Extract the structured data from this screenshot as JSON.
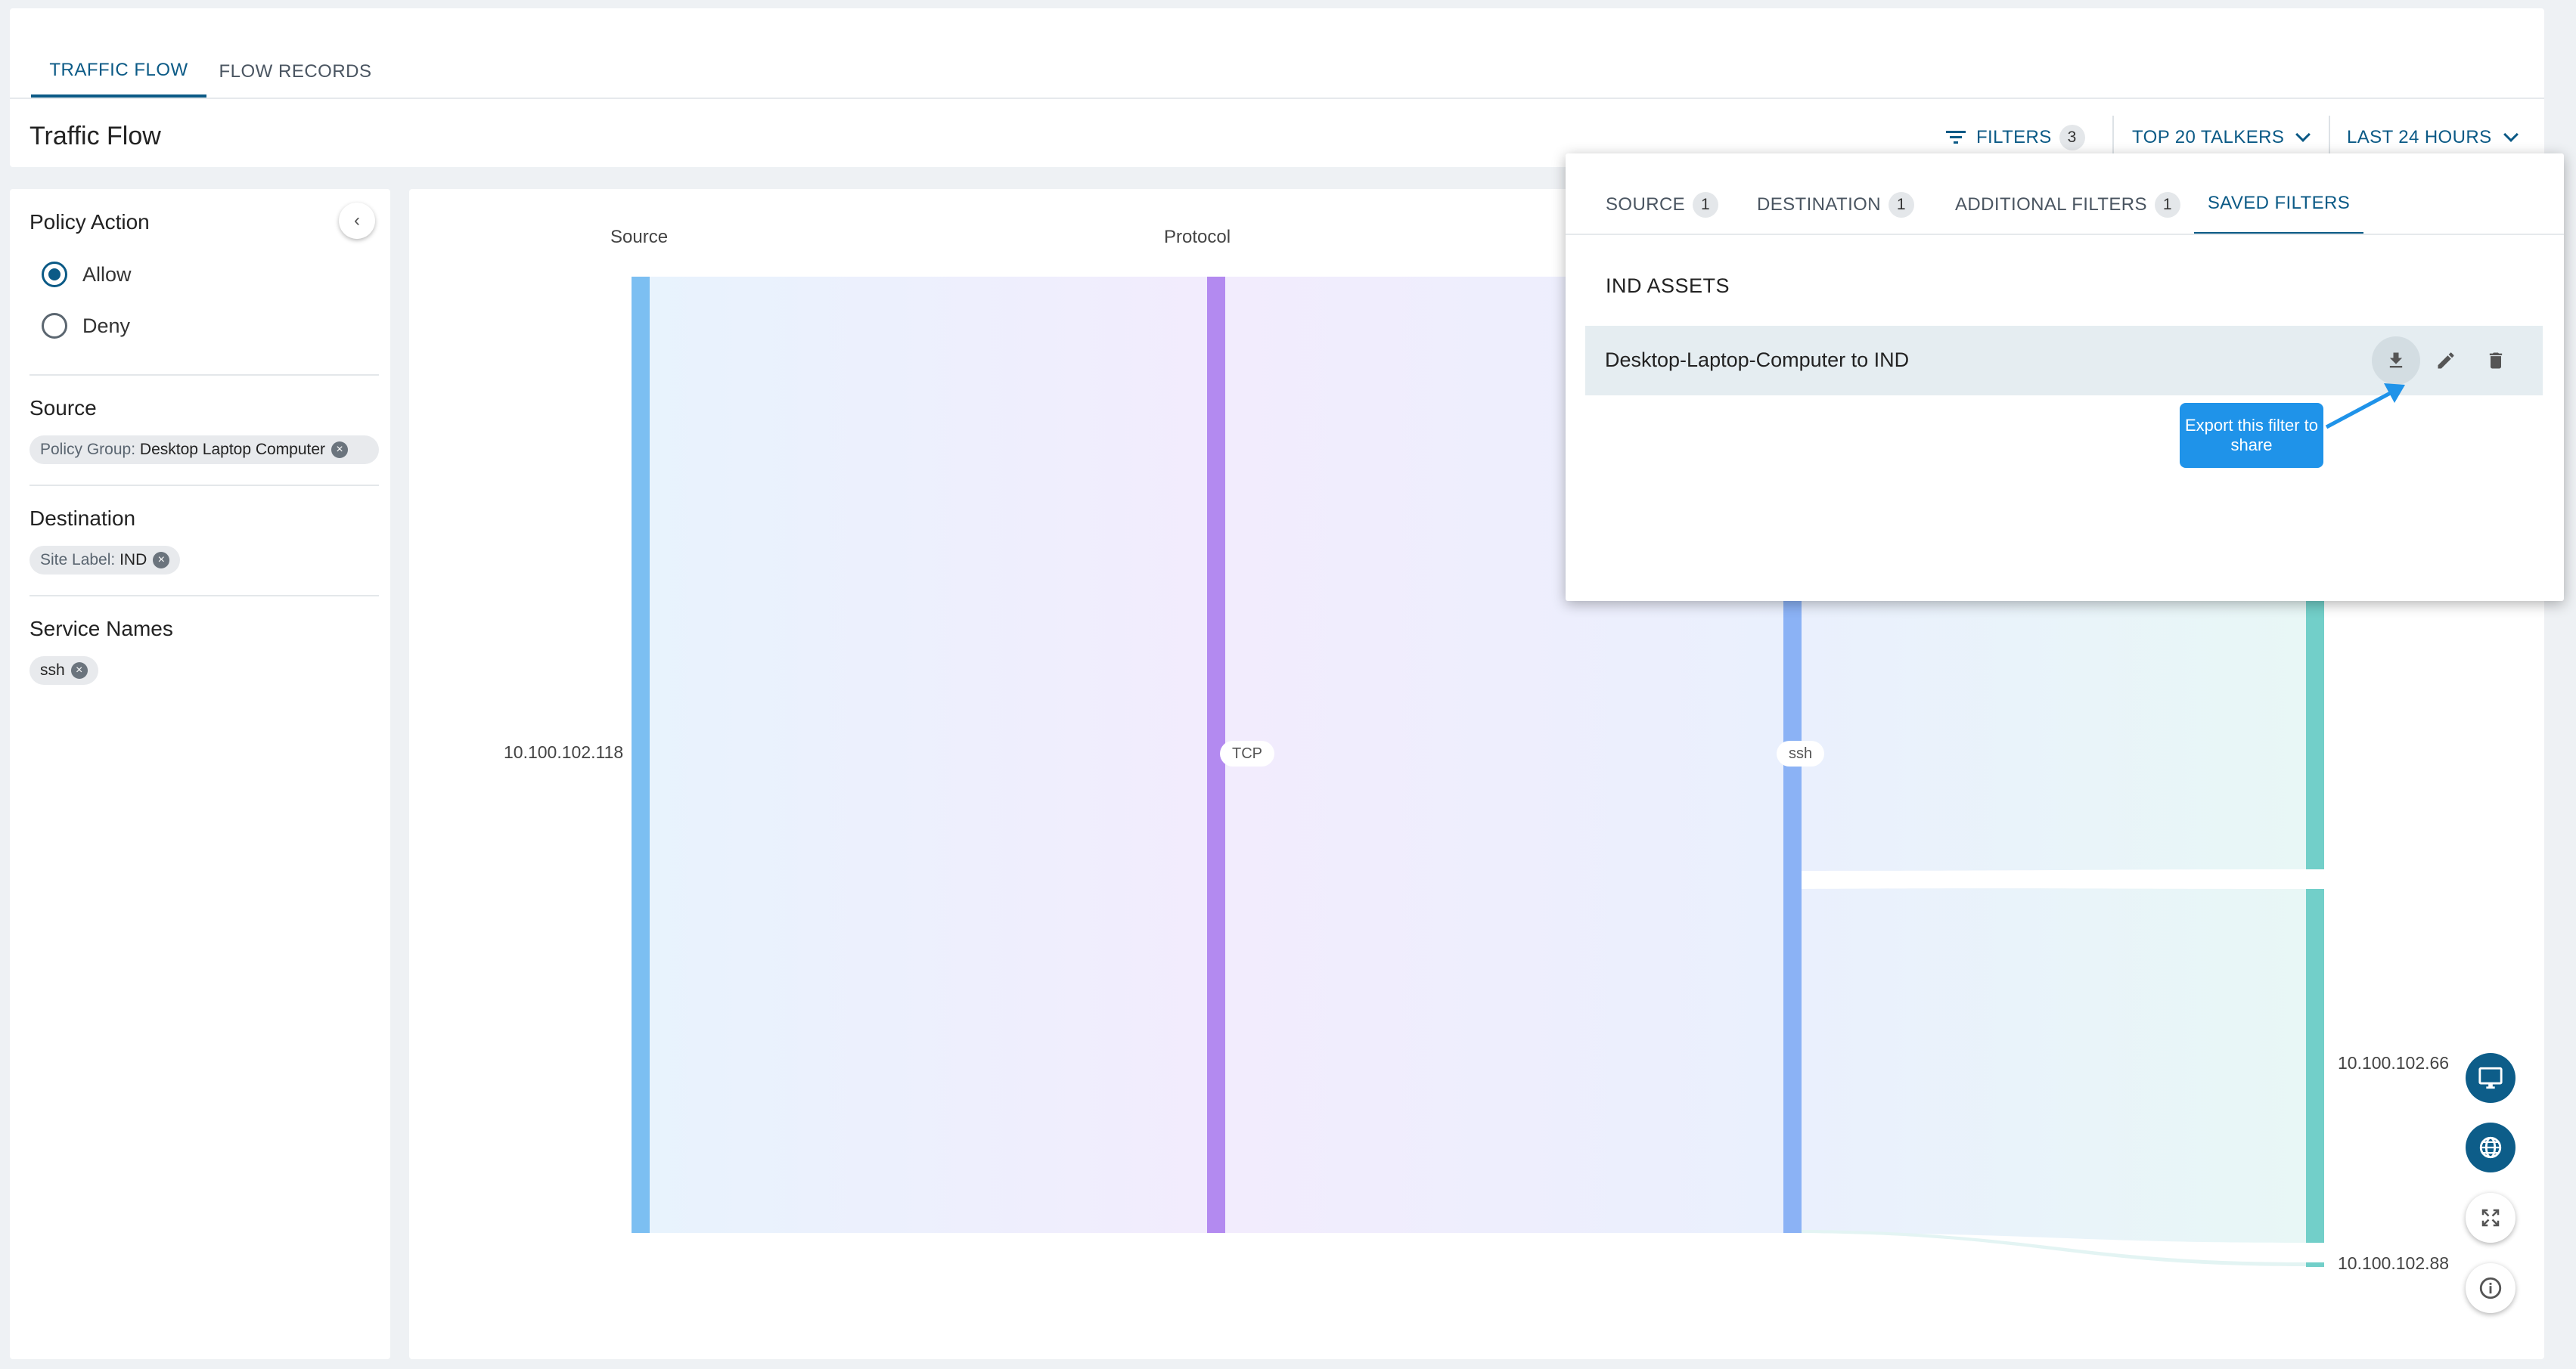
{
  "tabs": [
    {
      "label": "TRAFFIC FLOW"
    },
    {
      "label": "FLOW RECORDS"
    }
  ],
  "page_title": "Traffic Flow",
  "toolbar": {
    "filters_label": "FILTERS",
    "filters_count": "3",
    "talkers_label": "TOP 20 TALKERS",
    "range_label": "LAST 24 HOURS"
  },
  "left_panel": {
    "policy_action": {
      "label": "Policy Action",
      "options": [
        "Allow",
        "Deny"
      ],
      "selected": "Allow"
    },
    "source": {
      "label": "Source",
      "chip_key": "Policy Group:",
      "chip_value": "Desktop Laptop Computer"
    },
    "destination": {
      "label": "Destination",
      "chip_key": "Site Label:",
      "chip_value": "IND"
    },
    "service_names": {
      "label": "Service Names",
      "chip_value": "ssh"
    }
  },
  "sankey": {
    "columns": [
      "Source",
      "Protocol"
    ],
    "nodes": {
      "source": "10.100.102.118",
      "protocol": "TCP",
      "service": "ssh",
      "destinations": [
        "10.100.102.66",
        "10.100.102.88"
      ]
    },
    "colors": {
      "source": "#7cbff2",
      "protocol": "#b38af0",
      "service": "#8bb2f5",
      "destination": "#72cfc9"
    }
  },
  "popover": {
    "tabs": [
      {
        "label": "SOURCE",
        "count": "1"
      },
      {
        "label": "DESTINATION",
        "count": "1"
      },
      {
        "label": "ADDITIONAL FILTERS",
        "count": "1"
      },
      {
        "label": "SAVED FILTERS",
        "count": ""
      }
    ],
    "group_title": "IND ASSETS",
    "saved_filter_name": "Desktop-Laptop-Computer to IND",
    "tooltip": "Export this filter to share",
    "icons": [
      "download-icon",
      "edit-icon",
      "delete-icon"
    ]
  },
  "fabs": [
    "monitor-icon",
    "globe-icon",
    "fullscreen-icon",
    "info-icon"
  ],
  "accent_color": "#0b5a86"
}
